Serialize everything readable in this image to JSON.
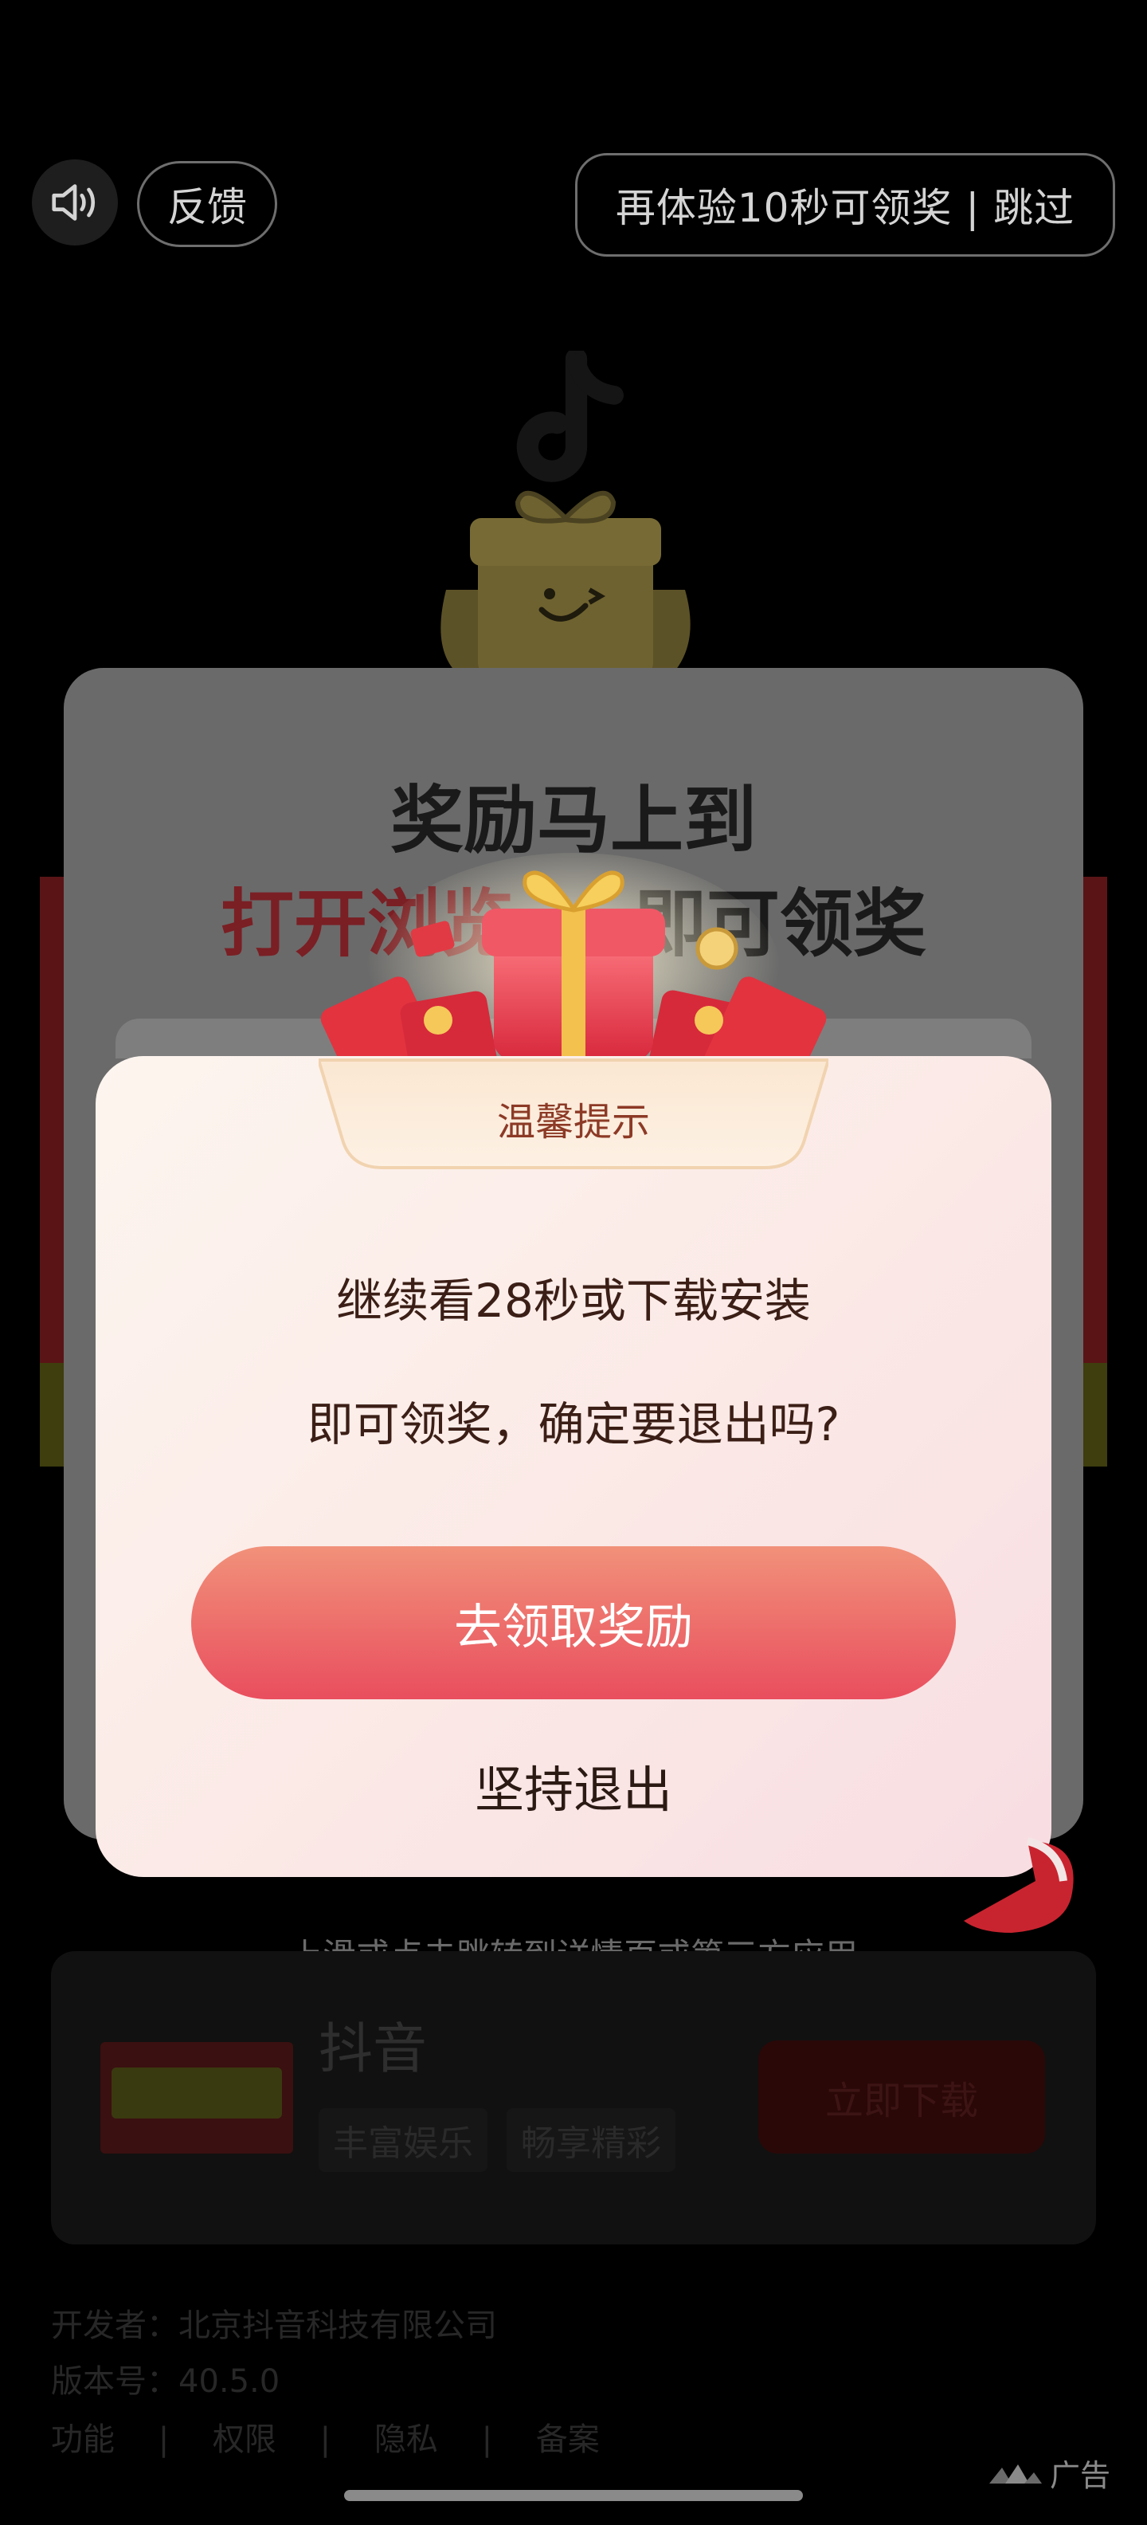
{
  "top_bar": {
    "feedback_label": "反馈",
    "skip_label": "再体验10秒可领奖 | 跳过"
  },
  "background_card": {
    "title": "奖励马上到",
    "subtitle_red": "打开浏览",
    "subtitle_black": "即可领奖"
  },
  "dialog": {
    "tab_label": "温馨提示",
    "message_line1": "继续看28秒或下载安装",
    "message_line2": "即可领奖，确定要退出吗?",
    "primary_button": "去领取奖励",
    "secondary_button": "坚持退出"
  },
  "page": {
    "swipe_hint": "上滑或点击跳转到详情页或第三方应用",
    "app_name": "抖音",
    "tags": [
      "丰富娱乐",
      "畅享精彩"
    ],
    "download_button": "立即下载",
    "developer": "开发者：北京抖音科技有限公司",
    "version": "版本号：40.5.0",
    "links": [
      "功能",
      "|",
      "权限",
      "|",
      "隐私",
      "|",
      "备案"
    ],
    "ad_label": "广告"
  },
  "colors": {
    "primary_button_top": "#f1917a",
    "primary_button_bottom": "#e94e5e",
    "dialog_bg": "#fbe9e6"
  },
  "icons": {
    "sound": "speaker-icon",
    "ad": "ad-logo-icon"
  }
}
